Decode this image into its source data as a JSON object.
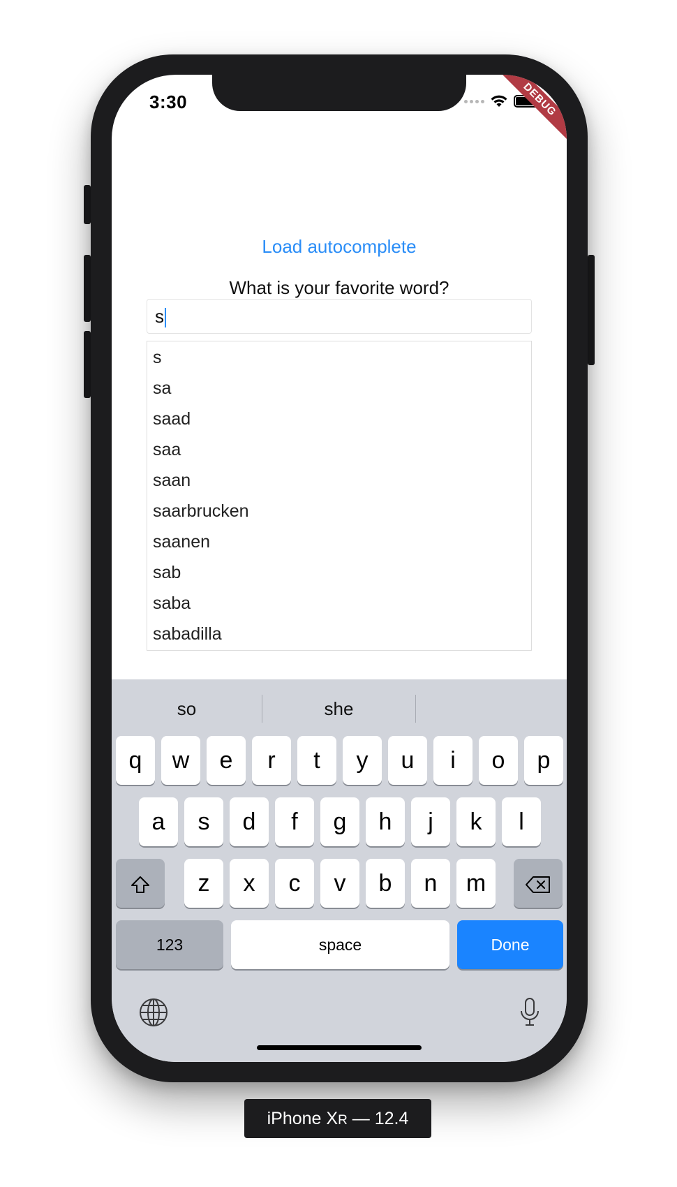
{
  "device": {
    "label_prefix": "iPhone X",
    "label_suffix": "R",
    "label_version": " — 12.4"
  },
  "status_bar": {
    "time": "3:30",
    "debug_banner": "DEBUG"
  },
  "app": {
    "load_link": "Load autocomplete",
    "question": "What is your favorite word?",
    "input_value": "s",
    "suggestions": [
      "s",
      "sa",
      "saad",
      "saa",
      "saan",
      "saarbrucken",
      "saanen",
      "sab",
      "saba",
      "sabadilla"
    ]
  },
  "keyboard": {
    "predictions": [
      "so",
      "she",
      ""
    ],
    "row1": [
      "q",
      "w",
      "e",
      "r",
      "t",
      "y",
      "u",
      "i",
      "o",
      "p"
    ],
    "row2": [
      "a",
      "s",
      "d",
      "f",
      "g",
      "h",
      "j",
      "k",
      "l"
    ],
    "row3": [
      "z",
      "x",
      "c",
      "v",
      "b",
      "n",
      "m"
    ],
    "numbers_label": "123",
    "space_label": "space",
    "done_label": "Done",
    "accent_color": "#1a84ff"
  },
  "colors": {
    "link": "#2a8df7",
    "debug_ribbon": "#b13b44",
    "keyboard_bg": "#d1d4db"
  }
}
